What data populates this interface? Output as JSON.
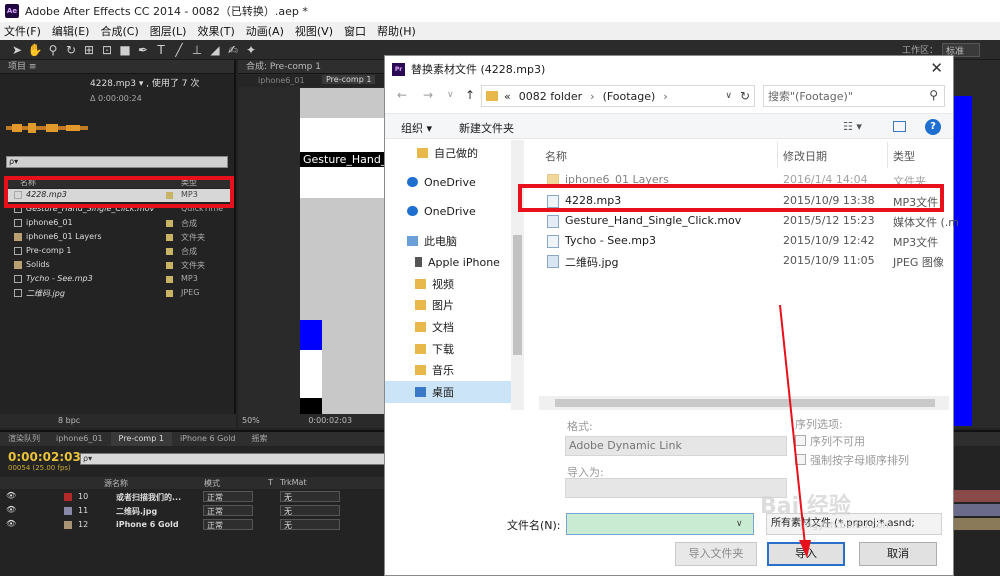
{
  "app": {
    "title": "Adobe After Effects CC 2014 - 0082（已转换）.aep *",
    "logo": "Ae",
    "menu": [
      "文件(F)",
      "编辑(E)",
      "合成(C)",
      "图层(L)",
      "效果(T)",
      "动画(A)",
      "视图(V)",
      "窗口",
      "帮助(H)"
    ],
    "workspace_label": "工作区：",
    "workspace_value": "标准"
  },
  "project": {
    "tab": "项目 ≡",
    "item_title": "4228.mp3 ▾ , 使用了 7 次",
    "item_duration": "Δ 0:00:00:24",
    "search_placeholder": "ρ▾",
    "col_name": "名称",
    "col_type": "类型",
    "rows": [
      {
        "name": "4228.mp3",
        "type": "MP3"
      },
      {
        "name": "Gesture_Hand_Single_Click.mov",
        "type": "QuickTime"
      },
      {
        "name": "iphone6_01",
        "type": "合成"
      },
      {
        "name": "iphone6_01 Layers",
        "type": "文件夹"
      },
      {
        "name": "Pre-comp 1",
        "type": "合成"
      },
      {
        "name": "Solids",
        "type": "文件夹"
      },
      {
        "name": "Tycho - See.mp3",
        "type": "MP3"
      },
      {
        "name": "二维码.jpg",
        "type": "JPEG"
      }
    ],
    "bpc": "8 bpc"
  },
  "composition": {
    "tab": "合成: Pre-comp 1",
    "subtab_left": "iphone6_01",
    "subtab_right": "Pre-comp 1",
    "overlay_text": "Gesture_Hand_",
    "zoom": "50%",
    "time": "0:00:02:03"
  },
  "timeline": {
    "tabs": [
      "渲染队列",
      "iphone6_01",
      "Pre-comp 1",
      "iPhone 6 Gold",
      "摇索"
    ],
    "current_time": "0:00:02:03",
    "fps": "00054 (25.00 fps)",
    "search_placeholder": "ρ▾",
    "col_source": "源名称",
    "col_mode": "模式",
    "col_t": "T",
    "col_trkmat": "TrkMat",
    "layers": [
      {
        "num": "10",
        "name": "或者扫描我们的...",
        "mode": "正常",
        "trkmat": "无",
        "color": "#b22a2a"
      },
      {
        "num": "11",
        "name": "二维码.jpg",
        "mode": "正常",
        "trkmat": "无",
        "color": "#8a8aa8"
      },
      {
        "num": "12",
        "name": "iPhone 6 Gold",
        "mode": "正常",
        "trkmat": "无",
        "color": "#a89474"
      }
    ]
  },
  "dialog": {
    "title": "替换素材文件 (4228.mp3)",
    "logo": "Pr",
    "path": [
      "«",
      "0082 folder",
      "›",
      "(Footage)",
      "›"
    ],
    "search_placeholder": "搜索\"(Footage)\"",
    "organize": "组织 ▾",
    "new_folder": "新建文件夹",
    "nav_items": [
      {
        "label": "自己做的",
        "icon": "folder-icon"
      },
      {
        "label": "OneDrive",
        "icon": "cloud-icon"
      },
      {
        "label": "OneDrive",
        "icon": "cloud-icon"
      },
      {
        "label": "此电脑",
        "icon": "computer-icon"
      },
      {
        "label": "Apple iPhone",
        "icon": "phone-icon"
      },
      {
        "label": "视频",
        "icon": "video-folder-icon"
      },
      {
        "label": "图片",
        "icon": "picture-folder-icon"
      },
      {
        "label": "文档",
        "icon": "document-folder-icon"
      },
      {
        "label": "下载",
        "icon": "download-folder-icon"
      },
      {
        "label": "音乐",
        "icon": "music-folder-icon"
      },
      {
        "label": "桌面",
        "icon": "desktop-folder-icon"
      }
    ],
    "columns": {
      "name": "名称",
      "date": "修改日期",
      "type": "类型"
    },
    "files": [
      {
        "name": "iphone6_01 Layers",
        "date": "2016/1/4 14:04",
        "type": "文件夹"
      },
      {
        "name": "4228.mp3",
        "date": "2015/10/9 13:38",
        "type": "MP3文件"
      },
      {
        "name": "Gesture_Hand_Single_Click.mov",
        "date": "2015/5/12 15:23",
        "type": "媒体文件 (.m"
      },
      {
        "name": "Tycho - See.mp3",
        "date": "2015/10/9 12:42",
        "type": "MP3文件"
      },
      {
        "name": "二维码.jpg",
        "date": "2015/10/9 11:05",
        "type": "JPEG 图像"
      }
    ],
    "format_label": "格式:",
    "format_value": "Adobe Dynamic Link",
    "import_as_label": "导入为:",
    "sequence_label": "序列选项:",
    "seq_unavailable": "序列不可用",
    "force_alpha": "强制按字母顺序排列",
    "filename_label": "文件名(N):",
    "filename_value": "",
    "filter_value": "所有素材文件 (*.prproj;*.asnd;",
    "btn_import_folder": "导入文件夹",
    "btn_import": "导入",
    "btn_cancel": "取消"
  },
  "watermark": {
    "text": "Bai 经验",
    "sub": "jingyan.baidu.com"
  },
  "colors": {
    "annotation_red": "#e8101a",
    "ae_time": "#e8c23a",
    "selection_blue": "#cce4f7",
    "blue_solid": "#0000ff"
  }
}
